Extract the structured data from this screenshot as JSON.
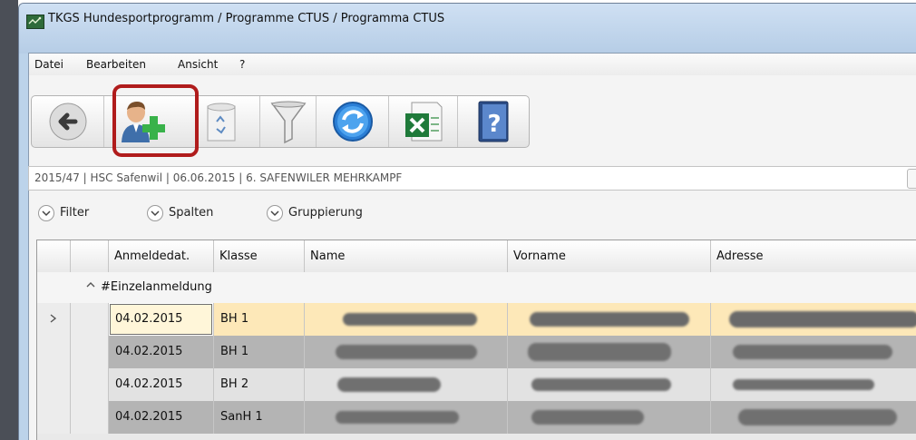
{
  "window": {
    "title": "TKGS Hundesportprogramm / Programme CTUS / Programma CTUS"
  },
  "menu": {
    "items": [
      "Datei",
      "Bearbeiten",
      "Ansicht",
      "?"
    ]
  },
  "toolbar": {
    "buttons": [
      {
        "name": "back",
        "icon": "back-arrow-icon"
      },
      {
        "name": "add-participant",
        "icon": "add-user-icon",
        "highlighted": true
      },
      {
        "name": "delete",
        "icon": "recycle-bin-icon"
      },
      {
        "name": "filter",
        "icon": "funnel-icon"
      },
      {
        "name": "refresh",
        "icon": "refresh-icon"
      },
      {
        "name": "excel-export",
        "icon": "excel-icon"
      },
      {
        "name": "help",
        "icon": "help-book-icon"
      }
    ],
    "highlight_color": "#b01c1c"
  },
  "event_info": "2015/47 | HSC Safenwil | 06.06.2015 | 6. SAFENWILER MEHRKAMPF",
  "filterbar": {
    "filter_label": "Filter",
    "columns_label": "Spalten",
    "grouping_label": "Gruppierung"
  },
  "grid": {
    "columns": [
      "Anmeldedat.",
      "Klasse",
      "Name",
      "Vorname",
      "Adresse"
    ],
    "group_label": "#Einzelanmeldung",
    "rows": [
      {
        "date": "04.02.2015",
        "klasse": "BH 1",
        "selected": true
      },
      {
        "date": "04.02.2015",
        "klasse": "BH 1",
        "selected": false
      },
      {
        "date": "04.02.2015",
        "klasse": "BH 2",
        "selected": false
      },
      {
        "date": "04.02.2015",
        "klasse": "SanH 1",
        "selected": false
      }
    ],
    "selected_row_color": "#fde8b8",
    "alt_row_color": "#b4b4b4"
  }
}
